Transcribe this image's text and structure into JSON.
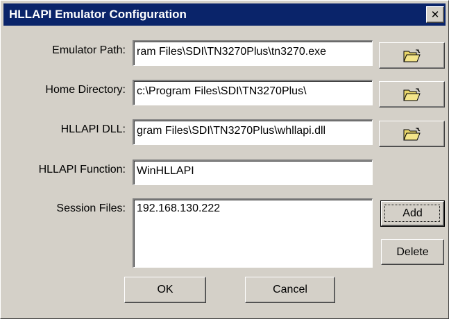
{
  "window": {
    "title": "HLLAPI Emulator Configuration",
    "close_glyph": "✕"
  },
  "form": {
    "emulator_path": {
      "label": "Emulator Path:",
      "value": "ram Files\\SDI\\TN3270Plus\\tn3270.exe"
    },
    "home_directory": {
      "label": "Home Directory:",
      "value": "c:\\Program Files\\SDI\\TN3270Plus\\"
    },
    "hllapi_dll": {
      "label": "HLLAPI DLL:",
      "value": "gram Files\\SDI\\TN3270Plus\\whllapi.dll"
    },
    "hllapi_function": {
      "label": "HLLAPI Function:",
      "value": "WinHLLAPI"
    },
    "session_files": {
      "label": "Session Files:",
      "items": [
        "192.168.130.222"
      ]
    }
  },
  "buttons": {
    "add": "Add",
    "delete": "Delete",
    "ok": "OK",
    "cancel": "Cancel"
  },
  "icons": {
    "browse": "open-folder-icon"
  },
  "colors": {
    "title_bar": "#0a246a",
    "dialog_face": "#d4d0c8",
    "folder_yellow": "#e8d56a"
  }
}
